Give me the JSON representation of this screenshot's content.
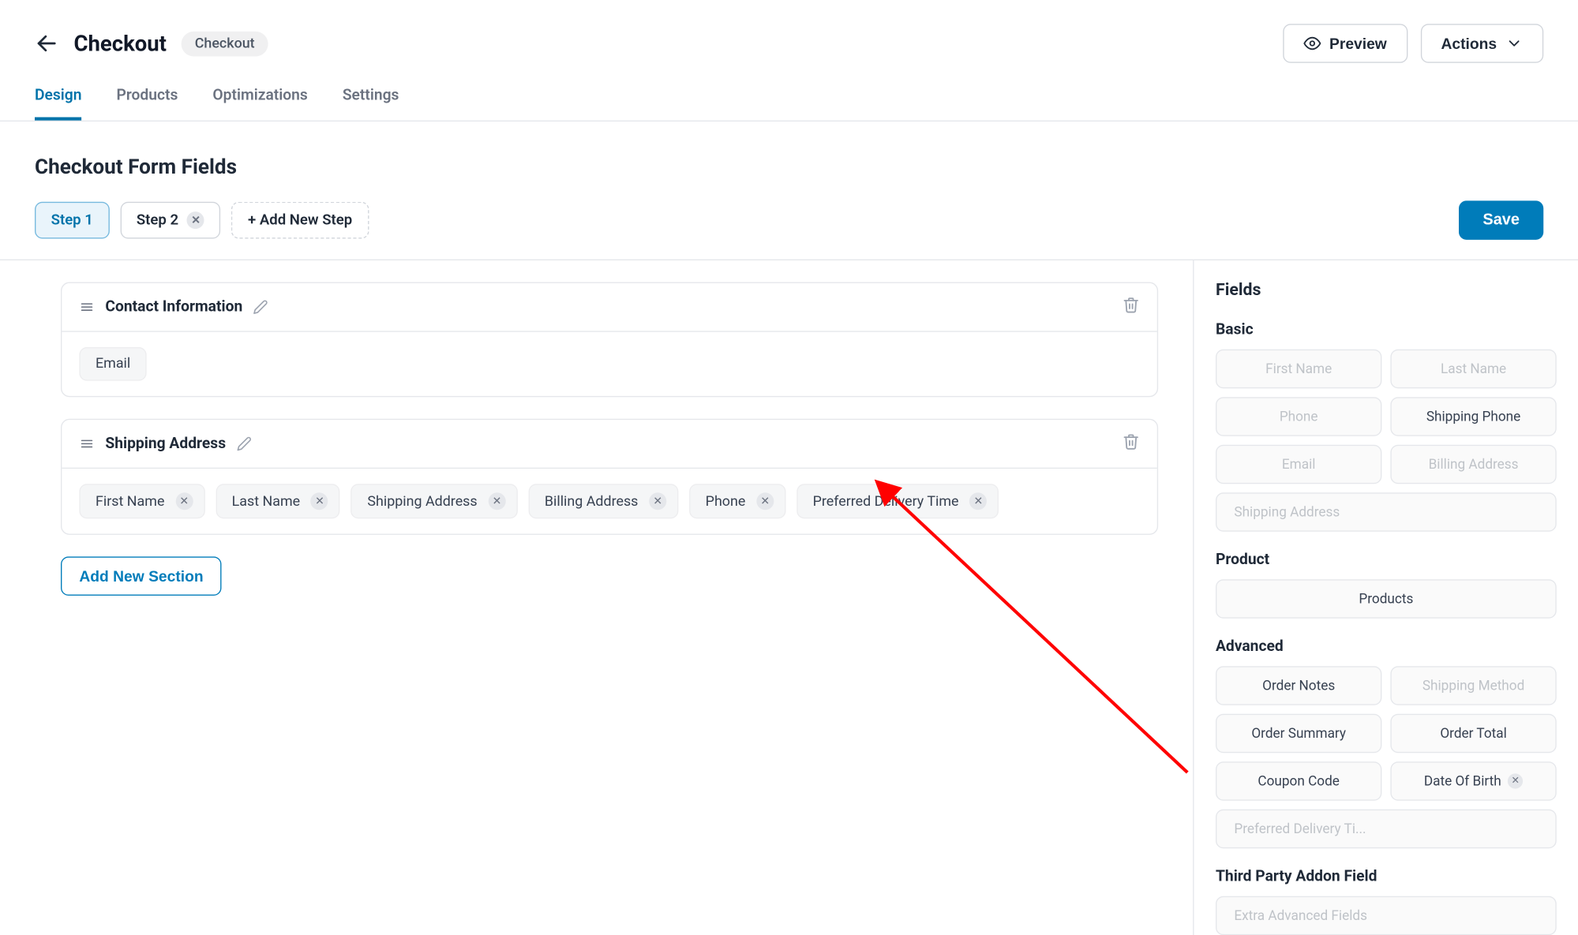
{
  "header": {
    "title": "Checkout",
    "badge": "Checkout",
    "preview_label": "Preview",
    "actions_label": "Actions"
  },
  "tabs": [
    {
      "label": "Design",
      "active": true
    },
    {
      "label": "Products",
      "active": false
    },
    {
      "label": "Optimizations",
      "active": false
    },
    {
      "label": "Settings",
      "active": false
    }
  ],
  "body": {
    "section_title": "Checkout Form Fields",
    "steps": [
      {
        "label": "Step 1",
        "active": true,
        "removable": false
      },
      {
        "label": "Step 2",
        "active": false,
        "removable": true
      }
    ],
    "add_step_label": "+ Add New Step",
    "save_label": "Save",
    "add_section_label": "Add New Section"
  },
  "sections": [
    {
      "title": "Contact Information",
      "fields": [
        {
          "label": "Email",
          "removable": false
        }
      ]
    },
    {
      "title": "Shipping Address",
      "fields": [
        {
          "label": "First Name",
          "removable": true
        },
        {
          "label": "Last Name",
          "removable": true
        },
        {
          "label": "Shipping Address",
          "removable": true
        },
        {
          "label": "Billing Address",
          "removable": true
        },
        {
          "label": "Phone",
          "removable": true
        },
        {
          "label": "Preferred Delivery Time",
          "removable": true
        }
      ]
    }
  ],
  "sidebar": {
    "title": "Fields",
    "groups": [
      {
        "title": "Basic",
        "items": [
          {
            "label": "First Name",
            "disabled": true
          },
          {
            "label": "Last Name",
            "disabled": true
          },
          {
            "label": "Phone",
            "disabled": true
          },
          {
            "label": "Shipping Phone",
            "disabled": false
          },
          {
            "label": "Email",
            "disabled": true
          },
          {
            "label": "Billing Address",
            "disabled": true
          },
          {
            "label": "Shipping Address",
            "disabled": true,
            "full": true
          }
        ]
      },
      {
        "title": "Product",
        "items": [
          {
            "label": "Products",
            "disabled": false,
            "full": true
          }
        ]
      },
      {
        "title": "Advanced",
        "items": [
          {
            "label": "Order Notes",
            "disabled": false
          },
          {
            "label": "Shipping Method",
            "disabled": true
          },
          {
            "label": "Order Summary",
            "disabled": false
          },
          {
            "label": "Order Total",
            "disabled": false
          },
          {
            "label": "Coupon Code",
            "disabled": false
          },
          {
            "label": "Date Of Birth",
            "disabled": false,
            "removable": true
          },
          {
            "label": "Preferred Delivery Ti...",
            "disabled": true,
            "full": true
          }
        ]
      },
      {
        "title": "Third Party Addon Field",
        "items": [
          {
            "label": "Extra Advanced Fields",
            "disabled": true,
            "full": true
          }
        ]
      }
    ]
  }
}
